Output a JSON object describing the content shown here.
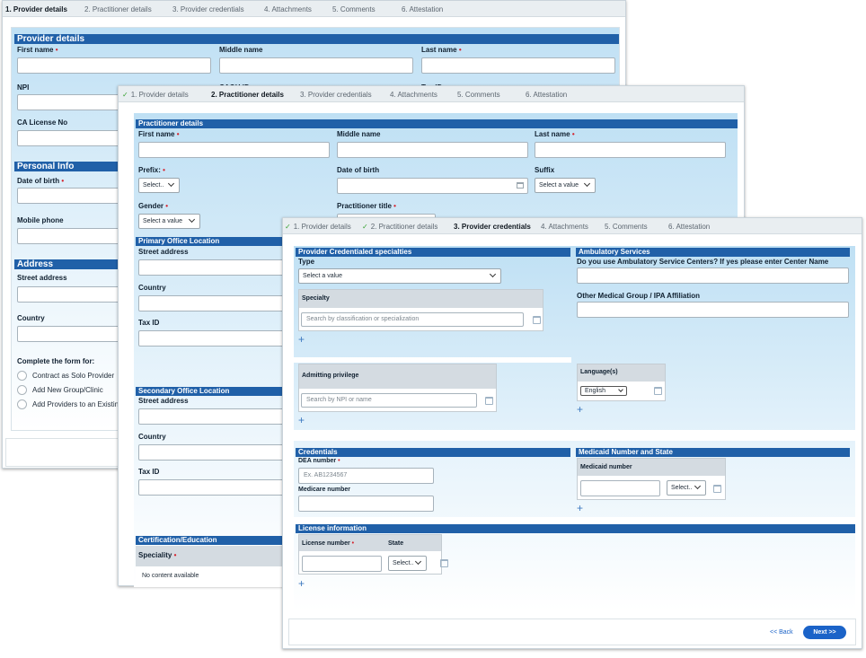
{
  "win1": {
    "steps": [
      "1. Provider details",
      "2. Practitioner details",
      "3. Provider credentials",
      "4. Attachments",
      "5. Comments",
      "6. Attestation"
    ],
    "section_provider": "Provider details",
    "first_name": "First name",
    "middle_name": "Middle name",
    "last_name": "Last name",
    "npi": "NPI",
    "caqh_id": "CAQH ID",
    "tax_id": "Tax ID",
    "ca_license": "CA License No",
    "section_personal": "Personal Info",
    "dob": "Date of birth",
    "mobile": "Mobile phone",
    "section_address": "Address",
    "street": "Street address",
    "country": "Country",
    "complete_form": "Complete the form for:",
    "options": [
      "Contract as Solo Provider",
      "Add New Group/Clinic",
      "Add Providers to an Existing"
    ]
  },
  "win2": {
    "steps": [
      "1. Provider details",
      "2. Practitioner details",
      "3. Provider credentials",
      "4. Attachments",
      "5. Comments",
      "6. Attestation"
    ],
    "section_practitioner": "Practitioner details",
    "first_name": "First name",
    "middle_name": "Middle name",
    "last_name": "Last name",
    "prefix": "Prefix:",
    "prefix_value": "Select..",
    "dob": "Date of birth",
    "suffix": "Suffix",
    "suffix_value": "Select a value",
    "gender": "Gender",
    "gender_value": "Select a value",
    "practitioner_title": "Practitioner title",
    "section_primary": "Primary Office Location",
    "street": "Street address",
    "country": "Country",
    "tax_id": "Tax ID",
    "section_secondary": "Secondary Office Location",
    "street2": "Street address",
    "country2": "Country",
    "tax_id2": "Tax ID",
    "section_cert": "Certification/Education",
    "speciality": "Speciality",
    "no_content": "No content available"
  },
  "win3": {
    "steps": [
      "1. Provider details",
      "2. Practitioner details",
      "3. Provider credentials",
      "4. Attachments",
      "5. Comments",
      "6. Attestation"
    ],
    "section_specialties": "Provider Credentialed specialties",
    "type": "Type",
    "type_value": "Select a value",
    "specialty_header": "Specialty",
    "specialty_placeholder": "Search by classification or specialization",
    "section_ambulatory": "Ambulatory Services",
    "ambulatory_question": "Do you use Ambulatory Service Centers? If yes please enter Center Name",
    "other_group": "Other Medical Group / IPA Affiliation",
    "admitting_header": "Admitting privilege",
    "admitting_placeholder": "Search by NPI or name",
    "language_header": "Language(s)",
    "language_value": "English",
    "section_credentials": "Credentials",
    "dea": "DEA number",
    "dea_placeholder": "Ex. AB1234567",
    "medicare": "Medicare number",
    "section_medicaid": "Medicaid Number and State",
    "medicaid_header": "Medicaid number",
    "medicaid_state_value": "Select..",
    "section_license": "License information",
    "license_header": "License number",
    "state_header": "State",
    "state_value": "Select..",
    "back": "<< Back",
    "next": "Next >>"
  },
  "colors": {
    "section_bar": "#2060a8",
    "required": "#d5202a",
    "next_button": "#1b63c8",
    "check": "#3aa335"
  }
}
